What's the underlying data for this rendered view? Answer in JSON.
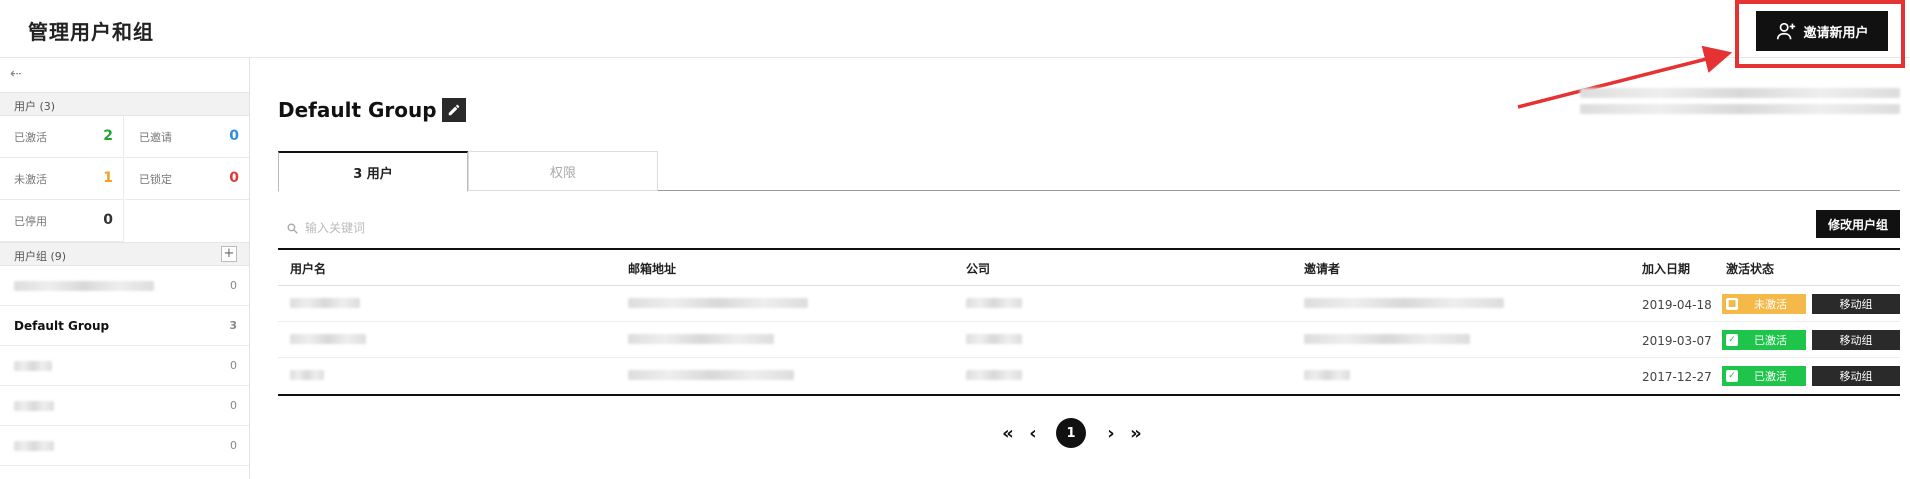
{
  "header": {
    "title": "管理用户和组",
    "invite_label": "邀请新用户"
  },
  "sidebar": {
    "users_section": "用户 (3)",
    "stats": [
      {
        "label": "已激活",
        "value": "2",
        "color": "#1fa52f"
      },
      {
        "label": "已邀请",
        "value": "0",
        "color": "#2e8ee0"
      },
      {
        "label": "未激活",
        "value": "1",
        "color": "#f0a020"
      },
      {
        "label": "已锁定",
        "value": "0",
        "color": "#e23838"
      },
      {
        "label": "已停用",
        "value": "0",
        "color": "#333333"
      }
    ],
    "groups_section": "用户组 (9)",
    "groups": [
      {
        "name": "",
        "count": "0",
        "blurred": true
      },
      {
        "name": "Default Group",
        "count": "3",
        "blurred": false
      },
      {
        "name": "",
        "count": "0",
        "blurred": true
      },
      {
        "name": "",
        "count": "0",
        "blurred": true
      },
      {
        "name": "",
        "count": "0",
        "blurred": true
      }
    ]
  },
  "main": {
    "group_title": "Default Group",
    "tabs": [
      {
        "label": "3 用户",
        "active": true
      },
      {
        "label": "权限",
        "active": false
      }
    ],
    "search_placeholder": "输入关键词",
    "edit_group_label": "修改用户组",
    "table": {
      "columns": [
        "用户名",
        "邮箱地址",
        "公司",
        "邀请者",
        "加入日期",
        "激活状态"
      ],
      "rows": [
        {
          "date": "2019-04-18",
          "status": "未激活",
          "status_type": "pending",
          "action": "移动组"
        },
        {
          "date": "2019-03-07",
          "status": "已激活",
          "status_type": "active",
          "action": "移动组"
        },
        {
          "date": "2017-12-27",
          "status": "已激活",
          "status_type": "active",
          "action": "移动组"
        }
      ]
    },
    "pagination": {
      "current_page": "1"
    }
  },
  "colors": {
    "accent": "#111111",
    "highlight": "#e53333",
    "status_pending": "#f5b94a",
    "status_active": "#1fc44a"
  }
}
